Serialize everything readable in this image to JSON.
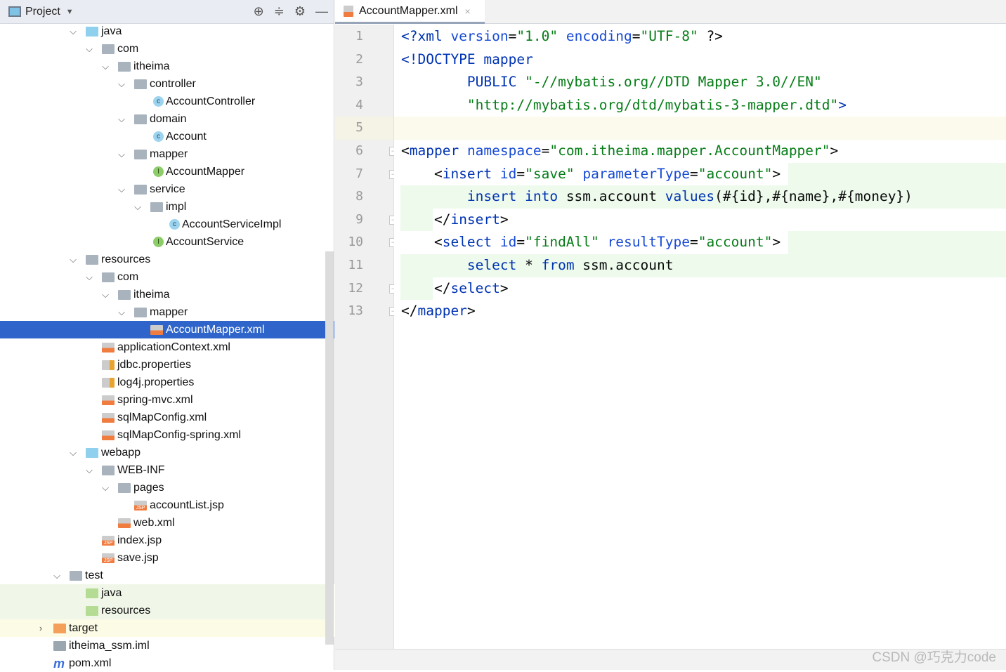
{
  "project_panel": {
    "title": "Project",
    "icons": [
      "locate-icon",
      "collapse-all-icon",
      "gear-icon",
      "minimize-icon"
    ]
  },
  "tree": [
    {
      "level": 0,
      "state": "open",
      "icon": "folder src",
      "label": "java"
    },
    {
      "level": 1,
      "state": "open",
      "icon": "folder",
      "label": "com"
    },
    {
      "level": 2,
      "state": "open",
      "icon": "folder",
      "label": "itheima"
    },
    {
      "level": 3,
      "state": "open",
      "icon": "folder",
      "label": "controller"
    },
    {
      "level": 4,
      "state": "none",
      "icon": "cls",
      "label": "AccountController"
    },
    {
      "level": 3,
      "state": "open",
      "icon": "folder",
      "label": "domain"
    },
    {
      "level": 4,
      "state": "none",
      "icon": "cls",
      "label": "Account"
    },
    {
      "level": 3,
      "state": "open",
      "icon": "folder",
      "label": "mapper"
    },
    {
      "level": 4,
      "state": "none",
      "icon": "intf",
      "label": "AccountMapper"
    },
    {
      "level": 3,
      "state": "open",
      "icon": "folder",
      "label": "service"
    },
    {
      "level": 4,
      "state": "open",
      "icon": "folder",
      "label": "impl"
    },
    {
      "level": 5,
      "state": "none",
      "icon": "cls",
      "label": "AccountServiceImpl"
    },
    {
      "level": 4,
      "state": "none",
      "icon": "intf",
      "label": "AccountService"
    },
    {
      "level": 0,
      "state": "open",
      "icon": "folder",
      "label": "resources"
    },
    {
      "level": 1,
      "state": "open",
      "icon": "folder",
      "label": "com"
    },
    {
      "level": 2,
      "state": "open",
      "icon": "folder",
      "label": "itheima"
    },
    {
      "level": 3,
      "state": "open",
      "icon": "folder",
      "label": "mapper"
    },
    {
      "level": 4,
      "state": "none",
      "icon": "xml",
      "label": "AccountMapper.xml",
      "selected": true
    },
    {
      "level": 1,
      "state": "none",
      "icon": "xml",
      "label": "applicationContext.xml"
    },
    {
      "level": 1,
      "state": "none",
      "icon": "prop",
      "label": "jdbc.properties"
    },
    {
      "level": 1,
      "state": "none",
      "icon": "prop",
      "label": "log4j.properties"
    },
    {
      "level": 1,
      "state": "none",
      "icon": "xml",
      "label": "spring-mvc.xml"
    },
    {
      "level": 1,
      "state": "none",
      "icon": "xml",
      "label": "sqlMapConfig.xml"
    },
    {
      "level": 1,
      "state": "none",
      "icon": "xml",
      "label": "sqlMapConfig-spring.xml"
    },
    {
      "level": 0,
      "state": "open",
      "icon": "folder src",
      "label": "webapp"
    },
    {
      "level": 1,
      "state": "open",
      "icon": "folder",
      "label": "WEB-INF"
    },
    {
      "level": 2,
      "state": "open",
      "icon": "folder",
      "label": "pages"
    },
    {
      "level": 3,
      "state": "none",
      "icon": "jsp",
      "label": "accountList.jsp"
    },
    {
      "level": 2,
      "state": "none",
      "icon": "xml",
      "label": "web.xml"
    },
    {
      "level": 1,
      "state": "none",
      "icon": "jsp",
      "label": "index.jsp"
    },
    {
      "level": 1,
      "state": "none",
      "icon": "jsp",
      "label": "save.jsp"
    },
    {
      "level": -1,
      "state": "open",
      "icon": "folder",
      "label": "test"
    },
    {
      "level": 0,
      "state": "none",
      "icon": "folder test",
      "label": "java",
      "bg": "g"
    },
    {
      "level": 0,
      "state": "none",
      "icon": "folder test",
      "label": "resources",
      "bg": "g"
    },
    {
      "level": -2,
      "state": "closed",
      "icon": "folder tgt",
      "label": "target",
      "bg": "y"
    },
    {
      "level": -2,
      "state": "none",
      "icon": "iml",
      "label": "itheima_ssm.iml"
    },
    {
      "level": -2,
      "state": "none",
      "icon": "mvn",
      "label": "pom.xml"
    }
  ],
  "editor": {
    "tab": {
      "label": "AccountMapper.xml",
      "close": "×"
    },
    "lines": [
      [
        [
          "tag",
          "<?"
        ],
        [
          "tag",
          "xml "
        ],
        [
          "attr",
          "version"
        ],
        [
          "txt",
          "="
        ],
        [
          "str",
          "\"1.0\""
        ],
        [
          "txt",
          " "
        ],
        [
          "attr",
          "encoding"
        ],
        [
          "txt",
          "="
        ],
        [
          "str",
          "\"UTF-8\""
        ],
        [
          "txt",
          " ?>"
        ]
      ],
      [
        [
          "tag",
          "<!DOCTYPE mapper"
        ]
      ],
      [
        [
          "txt",
          "        "
        ],
        [
          "tag",
          "PUBLIC "
        ],
        [
          "str",
          "\"-//mybatis.org//DTD Mapper 3.0//EN\""
        ]
      ],
      [
        [
          "txt",
          "        "
        ],
        [
          "str",
          "\"http://mybatis.org/dtd/mybatis-3-mapper.dtd\""
        ],
        [
          "tag",
          ">"
        ]
      ],
      [],
      [
        [
          "txt",
          "<"
        ],
        [
          "tag",
          "mapper "
        ],
        [
          "attr",
          "namespace"
        ],
        [
          "txt",
          "="
        ],
        [
          "str",
          "\"com.itheima.mapper.AccountMapper\""
        ],
        [
          "txt",
          ">"
        ]
      ],
      [
        [
          "txt",
          "    <"
        ],
        [
          "tag",
          "insert "
        ],
        [
          "attr",
          "id"
        ],
        [
          "txt",
          "="
        ],
        [
          "str",
          "\"save\""
        ],
        [
          "txt",
          " "
        ],
        [
          "attr",
          "parameterType"
        ],
        [
          "txt",
          "="
        ],
        [
          "str",
          "\"account\""
        ],
        [
          "txt",
          ">"
        ]
      ],
      [
        [
          "txt",
          "        "
        ],
        [
          "kw",
          "insert into "
        ],
        [
          "txt",
          "ssm.account "
        ],
        [
          "kw",
          "values"
        ],
        [
          "txt",
          "(#{id},#{name},#{money})"
        ]
      ],
      [
        [
          "txt",
          "    </"
        ],
        [
          "tag",
          "insert"
        ],
        [
          "txt",
          ">"
        ]
      ],
      [
        [
          "txt",
          "    <"
        ],
        [
          "tag",
          "select "
        ],
        [
          "attr",
          "id"
        ],
        [
          "txt",
          "="
        ],
        [
          "str",
          "\"findAll\""
        ],
        [
          "txt",
          " "
        ],
        [
          "attr",
          "resultType"
        ],
        [
          "txt",
          "="
        ],
        [
          "str",
          "\"account\""
        ],
        [
          "txt",
          ">"
        ]
      ],
      [
        [
          "txt",
          "        "
        ],
        [
          "kw",
          "select "
        ],
        [
          "txt",
          "* "
        ],
        [
          "kw",
          "from "
        ],
        [
          "txt",
          "ssm.account"
        ]
      ],
      [
        [
          "txt",
          "    </"
        ],
        [
          "tag",
          "select"
        ],
        [
          "txt",
          ">"
        ]
      ],
      [
        [
          "txt",
          "</"
        ],
        [
          "tag",
          "mapper"
        ],
        [
          "txt",
          ">"
        ]
      ]
    ],
    "line_numbers": [
      "1",
      "2",
      "3",
      "4",
      "5",
      "6",
      "7",
      "8",
      "9",
      "10",
      "11",
      "12",
      "13"
    ],
    "current_line": 5
  },
  "watermark": "CSDN @巧克力code"
}
